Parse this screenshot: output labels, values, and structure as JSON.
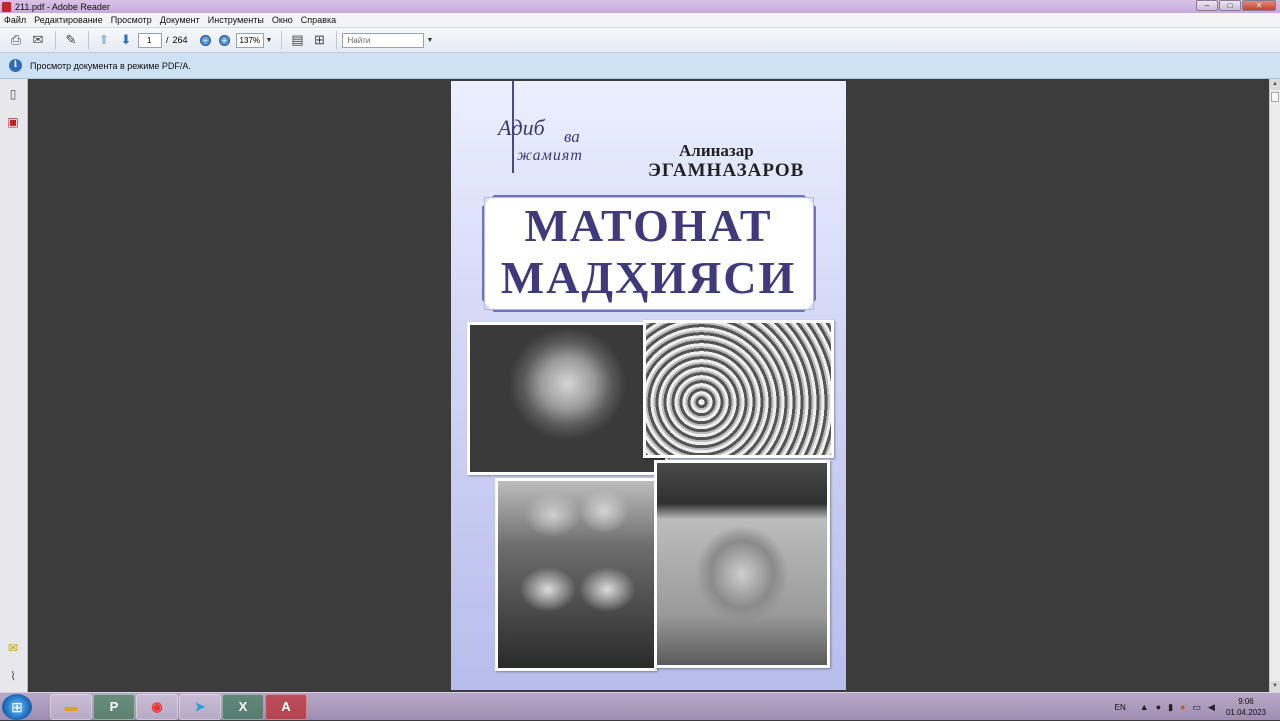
{
  "window": {
    "title": "211.pdf - Adobe Reader"
  },
  "menu": [
    "Файл",
    "Редактирование",
    "Просмотр",
    "Документ",
    "Инструменты",
    "Окно",
    "Справка"
  ],
  "toolbar": {
    "page_current": "1",
    "page_separator": "/",
    "page_total": "264",
    "zoom": "137%",
    "find_placeholder": "Найти"
  },
  "infobar": {
    "message": "Просмотр документа в режиме PDF/A."
  },
  "cover": {
    "series_top": "Адиб",
    "series_va": "ва",
    "series_bottom": "жамият",
    "author_first": "Алиназар",
    "author_last": "ЭГАМНАЗАРОВ",
    "title_line1": "МАТОНАТ",
    "title_line2": "МАДҲИЯСИ"
  },
  "taskbar": {
    "lang": "EN",
    "time": "9:06",
    "date": "01.04.2023"
  }
}
